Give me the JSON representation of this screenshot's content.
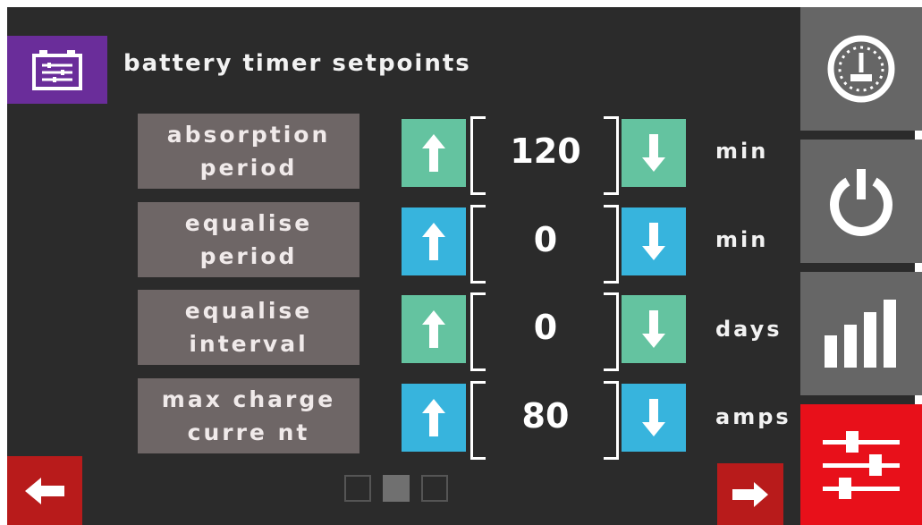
{
  "header": {
    "title": "battery timer setpoints",
    "icon": "battery-settings-icon"
  },
  "rows": [
    {
      "label_line1": "absorption",
      "label_line2": "period",
      "value": "120",
      "unit": "min",
      "color": "#64c3a0"
    },
    {
      "label_line1": "equalise",
      "label_line2": "period",
      "value": "0",
      "unit": "min",
      "color": "#37b4dd"
    },
    {
      "label_line1": "equalise",
      "label_line2": "interval",
      "value": "0",
      "unit": "days",
      "color": "#64c3a0"
    },
    {
      "label_line1": "max charge",
      "label_line2": "curre nt",
      "value": "80",
      "unit": "amps",
      "color": "#37b4dd"
    }
  ],
  "nav": [
    {
      "icon": "gauge-icon"
    },
    {
      "icon": "power-icon"
    },
    {
      "icon": "bar-chart-icon"
    },
    {
      "icon": "sliders-icon",
      "active": true
    }
  ],
  "pager": {
    "pages": 3,
    "current": 2
  },
  "colors": {
    "accent_purple": "#6a2d9a",
    "green": "#64c3a0",
    "blue": "#37b4dd",
    "red": "#e8101a",
    "dark_red": "#b81b1b",
    "background": "#2b2b2b"
  }
}
